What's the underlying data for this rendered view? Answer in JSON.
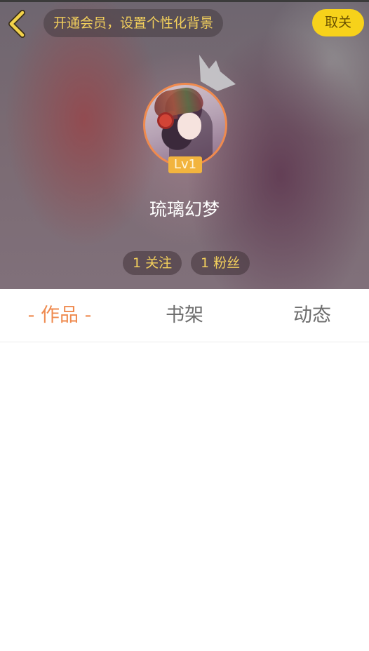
{
  "header": {
    "vip_banner": "开通会员，设置个性化背景",
    "unfollow_label": "取关"
  },
  "profile": {
    "level": "Lv1",
    "username": "琉璃幻梦",
    "following": "1 关注",
    "fans": "1 粉丝"
  },
  "tabs": [
    {
      "label": "- 作品 -",
      "active": true
    },
    {
      "label": "书架",
      "active": false
    },
    {
      "label": "动态",
      "active": false
    }
  ],
  "colors": {
    "accent": "#ef8a4e",
    "unfollow_bg": "#f7d21a",
    "gold_text": "#f2cf5c",
    "level_badge": "#f2b43e"
  },
  "icons": {
    "back": "chevron-left-icon",
    "crown": "crown-icon"
  }
}
